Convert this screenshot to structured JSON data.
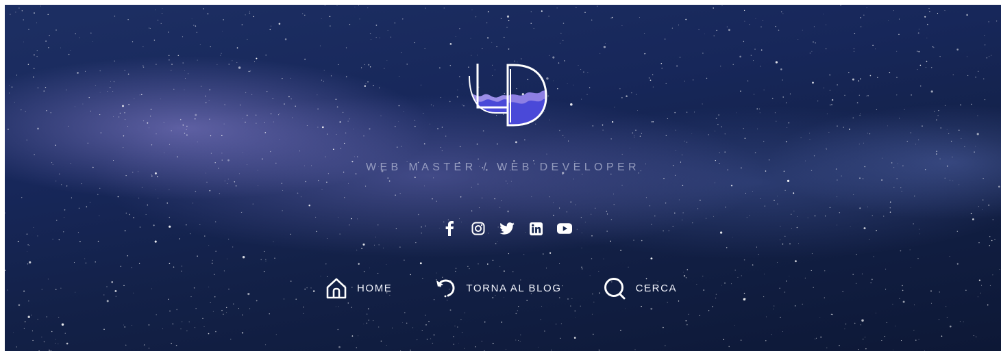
{
  "brand": {
    "logo_text": "LD",
    "tagline": "WEB MASTER / WEB DEVELOPER"
  },
  "social": [
    {
      "icon": "facebook-icon"
    },
    {
      "icon": "instagram-icon"
    },
    {
      "icon": "twitter-icon"
    },
    {
      "icon": "linkedin-icon"
    },
    {
      "icon": "youtube-icon"
    }
  ],
  "nav": {
    "home_label": "HOME",
    "back_label": "TORNA AL BLOG",
    "search_label": "CERCA"
  },
  "colors": {
    "accent": "#5b5ce0",
    "sky_dark": "#132148",
    "text": "#f1f3fb"
  }
}
